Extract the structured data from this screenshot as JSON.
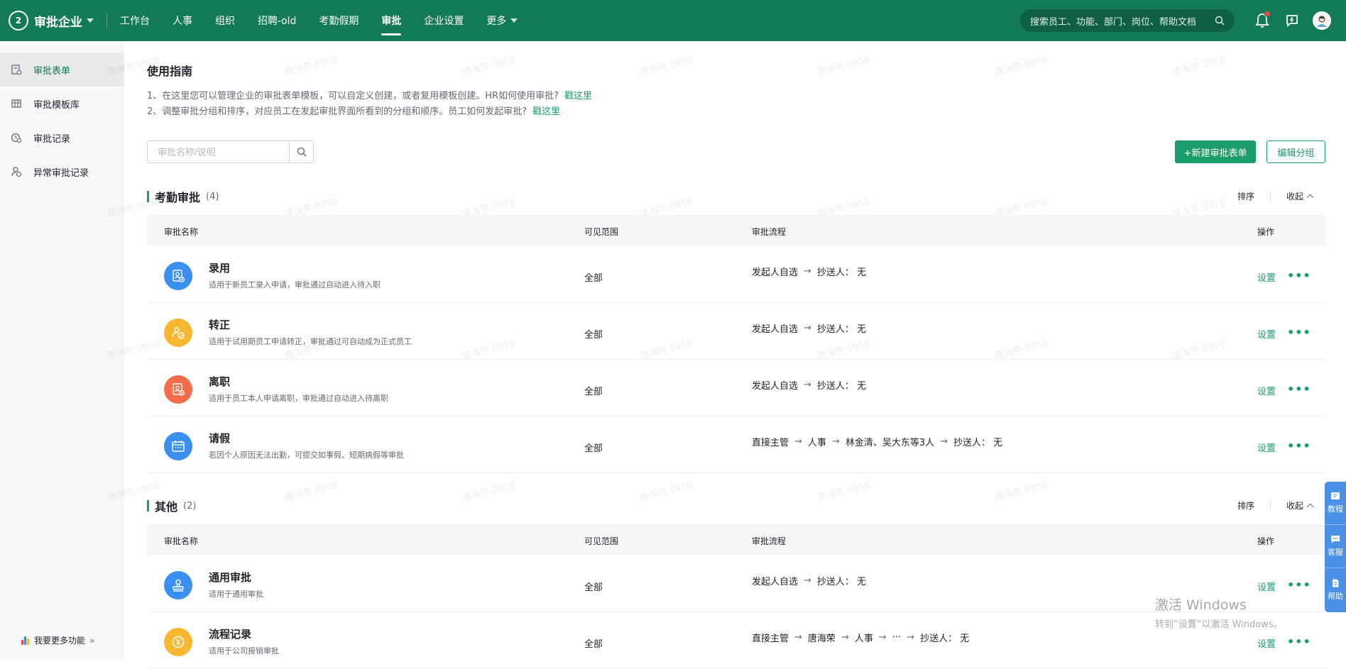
{
  "topbar": {
    "brand": "审批企业",
    "logo_text": "2",
    "nav": [
      "工作台",
      "人事",
      "组织",
      "招聘-old",
      "考勤假期",
      "审批",
      "企业设置",
      "更多"
    ],
    "active_nav": "审批",
    "search_placeholder": "搜索员工、功能、部门、岗位、帮助文档"
  },
  "sidebar": {
    "items": [
      {
        "label": "审批表单",
        "icon": "form-icon"
      },
      {
        "label": "审批模板库",
        "icon": "template-icon"
      },
      {
        "label": "审批记录",
        "icon": "record-icon"
      },
      {
        "label": "异常审批记录",
        "icon": "abnormal-icon"
      }
    ],
    "active": "审批表单",
    "footer": "我要更多功能"
  },
  "guide": {
    "title": "使用指南",
    "line1": "1、在这里您可以管理企业的审批表单模板，可以自定义创建，或者复用模板创建。HR如何使用审批?",
    "line2": "2、调整审批分组和排序，对应员工在发起审批界面所看到的分组和顺序。员工如何发起审批?",
    "link": "戳这里"
  },
  "toolbar": {
    "search_placeholder": "审批名称/说明",
    "new_button": "+新建审批表单",
    "edit_group_button": "编辑分组"
  },
  "table_headers": {
    "name": "审批名称",
    "scope": "可见范围",
    "flow": "审批流程",
    "op": "操作"
  },
  "row_actions": {
    "set": "设置",
    "more": "•••"
  },
  "group_actions": {
    "sort": "排序",
    "collapse": "收起"
  },
  "groups": [
    {
      "name": "考勤审批",
      "count": "(4)",
      "rows": [
        {
          "title": "录用",
          "desc": "适用于新员工录入申请，审批通过自动进入待入职",
          "scope": "全部",
          "flow": [
            "发起人自选",
            "抄送人： 无"
          ],
          "color": "#3b8ff0",
          "icon": "onboard-icon"
        },
        {
          "title": "转正",
          "desc": "适用于试用期员工申请转正，审批通过可自动成为正式员工",
          "scope": "全部",
          "flow": [
            "发起人自选",
            "抄送人： 无"
          ],
          "color": "#f7b731",
          "icon": "regularize-icon"
        },
        {
          "title": "离职",
          "desc": "适用于员工本人申请离职，审批通过自动进入待离职",
          "scope": "全部",
          "flow": [
            "发起人自选",
            "抄送人： 无"
          ],
          "color": "#f56c4b",
          "icon": "resign-icon"
        },
        {
          "title": "请假",
          "desc": "若因个人原因无法出勤，可提交如事假、短期病假等审批",
          "scope": "全部",
          "flow": [
            "直接主管",
            "人事",
            "林金清、吴大东等3人",
            "抄送人： 无"
          ],
          "color": "#3b8ff0",
          "icon": "calendar-icon"
        }
      ]
    },
    {
      "name": "其他",
      "count": "(2)",
      "rows": [
        {
          "title": "通用审批",
          "desc": "适用于通用审批",
          "scope": "全部",
          "flow": [
            "发起人自选",
            "抄送人： 无"
          ],
          "color": "#3b8ff0",
          "icon": "stamp-icon"
        },
        {
          "title": "流程记录",
          "desc": "适用于公司报销审批",
          "scope": "全部",
          "flow": [
            "直接主管",
            "唐海荣",
            "人事",
            "···",
            "抄送人： 无"
          ],
          "color": "#f7b731",
          "icon": "yuan-icon"
        }
      ]
    }
  ],
  "watermark": "唐海荣 0958",
  "float_help": [
    "教程",
    "客服",
    "帮助"
  ],
  "activation": {
    "line1": "激活 Windows",
    "line2": "转到“设置”以激活 Windows。"
  },
  "colors": {
    "brand": "#127a55",
    "accent": "#1a9c6b"
  }
}
